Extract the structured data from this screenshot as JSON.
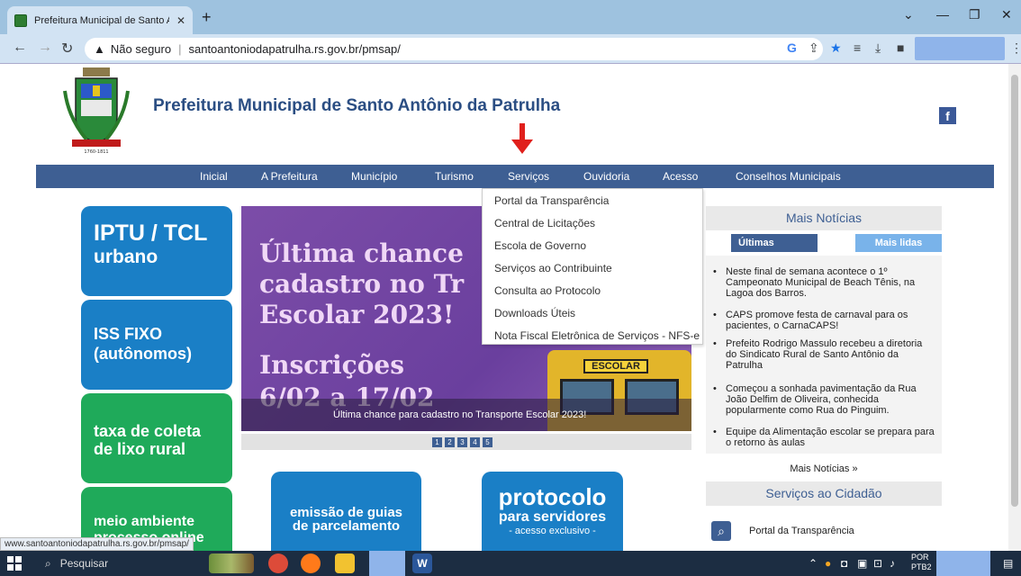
{
  "browser": {
    "tab_title": "Prefeitura Municipal de Santo An",
    "tab_close": "✕",
    "new_tab": "+",
    "security_label": "Não seguro",
    "url": "santoantoniodapatrulha.rs.gov.br/pmsap/",
    "window_minimize": "—",
    "window_restore": "❐",
    "window_close": "✕",
    "tab_menu": "⌄"
  },
  "site": {
    "title": "Prefeitura Municipal de Santo Antônio da Patrulha",
    "facebook": "f",
    "crest_year": "1760-1811",
    "nav": [
      "Inicial",
      "A Prefeitura",
      "Município",
      "Turismo",
      "Serviços",
      "Ouvidoria",
      "Acesso",
      "Conselhos Municipais"
    ],
    "dropdown": [
      "Portal da Transparência",
      "Central de Licitações",
      "Escola de Governo",
      "Serviços ao Contribuinte",
      "Consulta ao Protocolo",
      "Downloads Úteis",
      "Nota Fiscal Eletrônica de Serviços - NFS-e"
    ],
    "buttons": {
      "iptu_line1": "IPTU / TCL",
      "iptu_line2": "urbano",
      "iss_line1": "ISS FIXO",
      "iss_line2": "(autônomos)",
      "lixo_line1": "taxa de coleta",
      "lixo_line2": "de lixo rural",
      "meio_line1": "meio ambiente",
      "meio_line2": "processo online"
    },
    "slider": {
      "line1": "Última chance",
      "line2": "cadastro no Tr",
      "line3": "Escolar 2023!",
      "line4": "Inscrições",
      "line5": "6/02 a 17/02",
      "bus_sign": "ESCOLAR",
      "caption": "Última chance para cadastro no Transporte Escolar 2023!",
      "pages": [
        "1",
        "2",
        "3",
        "4",
        "5"
      ]
    },
    "tiles": {
      "guias_line1": "emissão de guias",
      "guias_line2": "de parcelamento",
      "protocolo_title": "protocolo",
      "protocolo_sub": "para servidores",
      "protocolo_note": "- acesso exclusivo -"
    },
    "news": {
      "title": "Mais Notícias",
      "tab_latest": "Últimas",
      "tab_most_read": "Mais lidas",
      "items": [
        "Neste final de semana acontece o 1º Campeonato Municipal de Beach Tênis, na Lagoa dos Barros.",
        "CAPS promove festa de carnaval para os pacientes, o CarnaCAPS!",
        "Prefeito Rodrigo Massulo recebeu a diretoria do Sindicato Rural de Santo Antônio da Patrulha",
        "Começou a sonhada pavimentação da Rua João Delfim de Oliveira, conhecida popularmente como Rua do Pinguim.",
        "Equipe da Alimentação escolar se prepara para o retorno às aulas"
      ],
      "more": "Mais Notícias »"
    },
    "services": {
      "title": "Serviços ao Cidadão",
      "item1": "Portal da Transparência"
    },
    "status_url": "www.santoantoniodapatrulha.rs.gov.br/pmsap/"
  },
  "taskbar": {
    "search_placeholder": "Pesquisar",
    "lang_line1": "POR",
    "lang_line2": "PTB2"
  },
  "colors": {
    "nav_blue": "#3e5f93",
    "tile_blue": "#1a7fc6",
    "tile_green": "#1faa5a",
    "slider_purple": "#7c4da8"
  }
}
